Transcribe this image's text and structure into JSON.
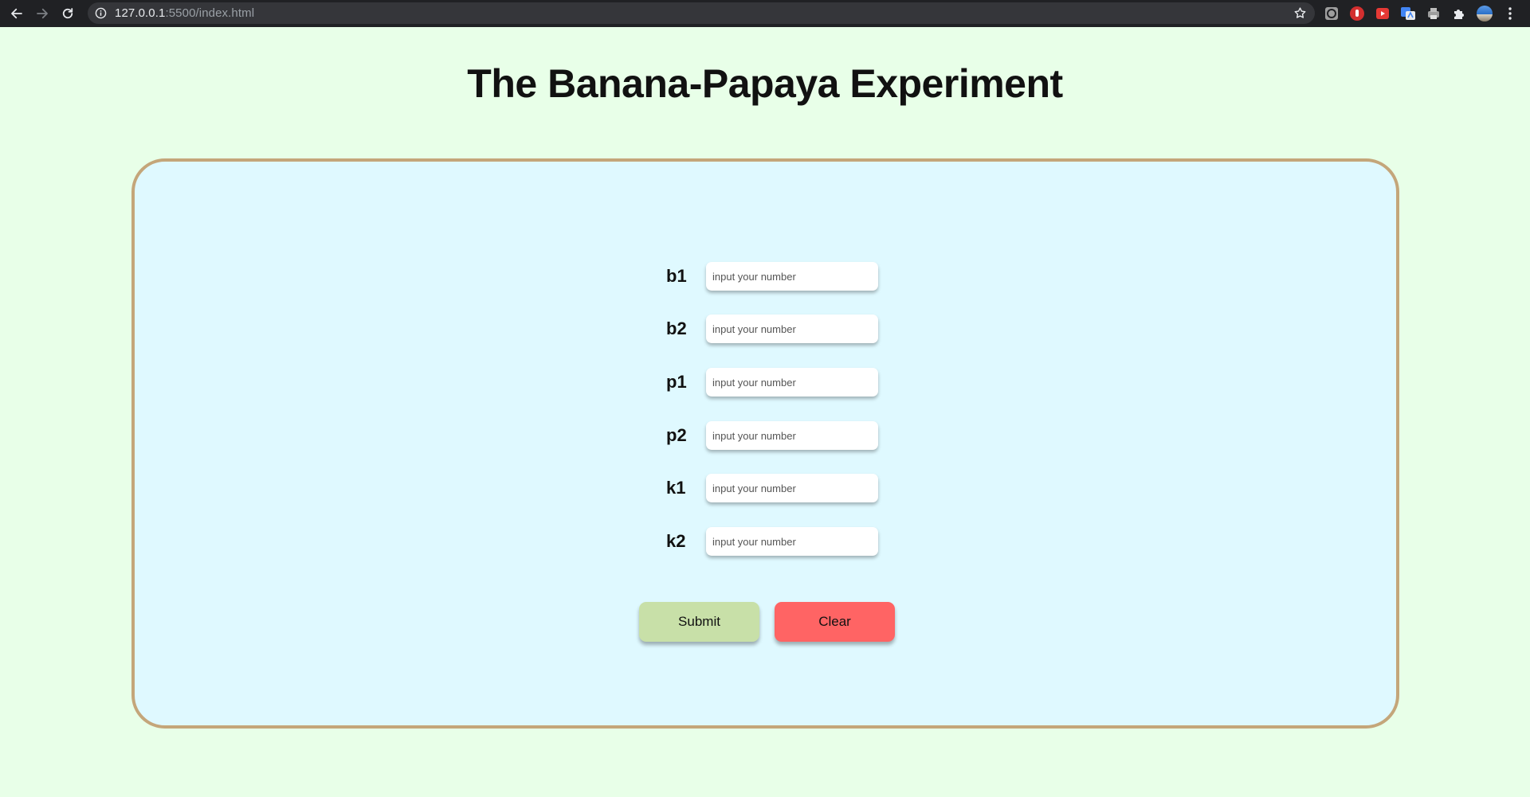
{
  "browser": {
    "url_host": "127.0.0.1",
    "url_rest": ":5500/index.html",
    "icons": [
      "back-arrow-icon",
      "forward-arrow-icon",
      "reload-icon",
      "info-icon",
      "star-icon",
      "extension-puzzle-icon",
      "profile-avatar",
      "more-menu-icon"
    ]
  },
  "page": {
    "title": "The Banana-Papaya Experiment"
  },
  "form": {
    "fields": [
      {
        "label": "b1",
        "placeholder": "input your number",
        "value": ""
      },
      {
        "label": "b2",
        "placeholder": "input your number",
        "value": ""
      },
      {
        "label": "p1",
        "placeholder": "input your number",
        "value": ""
      },
      {
        "label": "p2",
        "placeholder": "input your number",
        "value": ""
      },
      {
        "label": "k1",
        "placeholder": "input your number",
        "value": ""
      },
      {
        "label": "k2",
        "placeholder": "input your number",
        "value": ""
      }
    ],
    "submit_label": "Submit",
    "clear_label": "Clear"
  },
  "colors": {
    "page_background": "#e8ffe8",
    "card_background": "#dff9ff",
    "card_border": "#c4a67a",
    "submit_button": "#c8e0a8",
    "clear_button": "#ff6464"
  }
}
